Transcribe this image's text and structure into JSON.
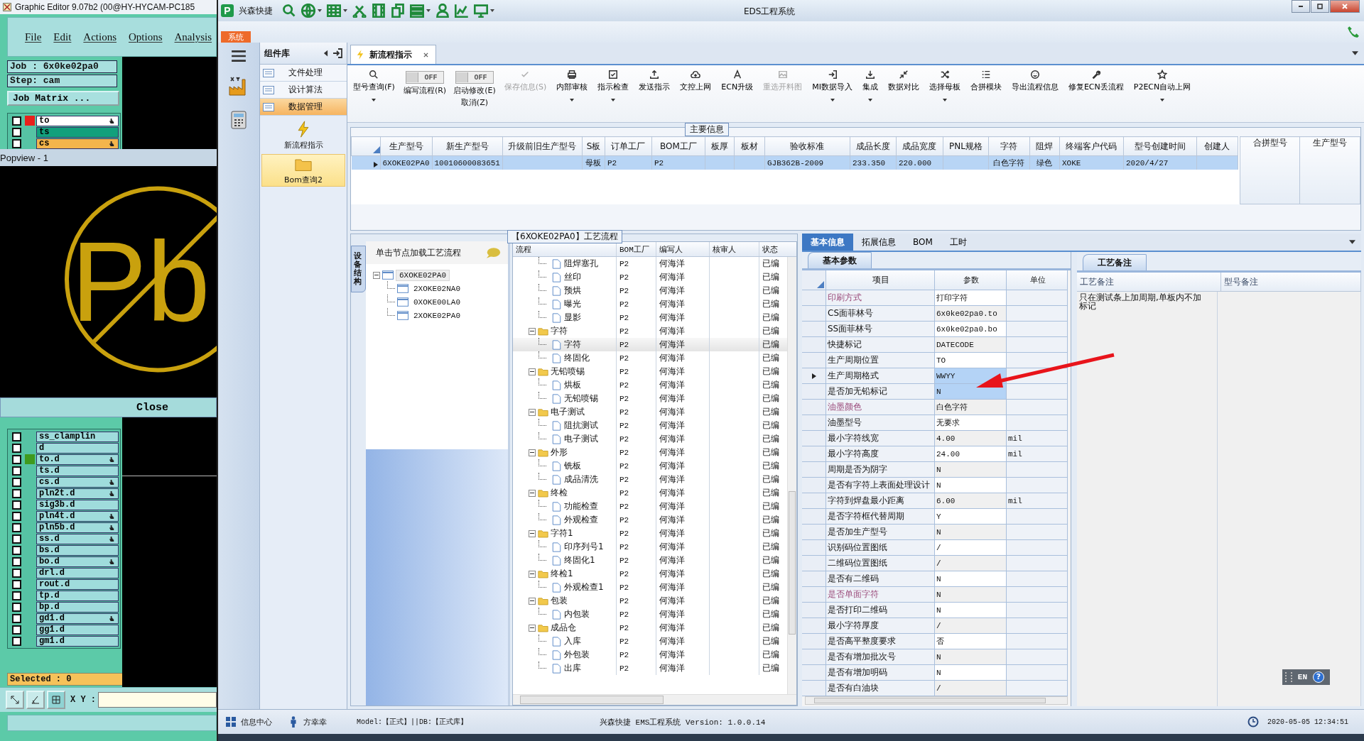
{
  "graphic_editor": {
    "title": "Graphic Editor 9.07b2 (00@HY-HYCAM-PC185",
    "menu": [
      "File",
      "Edit",
      "Actions",
      "Options",
      "Analysis"
    ],
    "job": "Job : 6x0ke02pa0",
    "step": "Step: cam",
    "job_matrix_button": "Job Matrix ...",
    "layers_top": [
      {
        "name": "to",
        "color": "#ffffff",
        "marker": {
          "color": "#e8201c"
        },
        "checked": false,
        "affected": true
      },
      {
        "name": "ts",
        "color": "#12a07c",
        "checked": false,
        "affected": false
      },
      {
        "name": "cs",
        "color": "#f4b54c",
        "checked": false,
        "affected": true
      }
    ],
    "popview": {
      "title": "Popview - 1",
      "symbol_text": "Pb",
      "close_button": "Close"
    },
    "layers_bottom": [
      {
        "name": "ss_clamplin",
        "color": "#9fdcdc",
        "checked": false,
        "affected": false
      },
      {
        "name": "d",
        "color": "#9fdcdc",
        "checked": false,
        "affected": false
      },
      {
        "name": "to.d",
        "color": "#9fdcdc",
        "marker": {
          "color": "#3f9a1e"
        },
        "checked": false,
        "affected": true
      },
      {
        "name": "ts.d",
        "color": "#9fdcdc",
        "checked": false,
        "affected": false
      },
      {
        "name": "cs.d",
        "color": "#9fdcdc",
        "checked": false,
        "affected": true
      },
      {
        "name": "pln2t.d",
        "color": "#9fdcdc",
        "checked": false,
        "affected": true
      },
      {
        "name": "sig3b.d",
        "color": "#9fdcdc",
        "checked": false,
        "affected": false
      },
      {
        "name": "pln4t.d",
        "color": "#9fdcdc",
        "checked": false,
        "affected": true
      },
      {
        "name": "pln5b.d",
        "color": "#9fdcdc",
        "checked": false,
        "affected": true
      },
      {
        "name": "ss.d",
        "color": "#9fdcdc",
        "checked": false,
        "affected": true
      },
      {
        "name": "bs.d",
        "color": "#9fdcdc",
        "checked": false,
        "affected": false
      },
      {
        "name": "bo.d",
        "color": "#9fdcdc",
        "checked": false,
        "affected": true
      },
      {
        "name": "drl.d",
        "color": "#9fdcdc",
        "checked": false,
        "affected": false
      },
      {
        "name": "rout.d",
        "color": "#9fdcdc",
        "checked": false,
        "affected": false
      },
      {
        "name": "tp.d",
        "color": "#9fdcdc",
        "checked": false,
        "affected": false
      },
      {
        "name": "bp.d",
        "color": "#9fdcdc",
        "checked": false,
        "affected": false
      },
      {
        "name": "gd1.d",
        "color": "#9fdcdc",
        "checked": false,
        "affected": true
      },
      {
        "name": "gg1.d",
        "color": "#9fdcdc",
        "checked": false,
        "affected": false
      },
      {
        "name": "gm1.d",
        "color": "#9fdcdc",
        "checked": false,
        "affected": false
      }
    ],
    "selected_count": "Selected : 0",
    "xy_label": "X Y :"
  },
  "app": {
    "logo_text": "P",
    "brand": "兴森快捷",
    "title": "EDS工程系统",
    "system_tab": "系统"
  },
  "component_library": {
    "title": "组件库",
    "categories": [
      {
        "label": "文件处理",
        "selected": false
      },
      {
        "label": "设计算法",
        "selected": false
      },
      {
        "label": "数据管理",
        "selected": true
      }
    ],
    "modules": [
      {
        "label": "新流程指示",
        "kind": "lightning",
        "selected": false
      },
      {
        "label": "Bom查询2",
        "kind": "folder",
        "selected": true
      }
    ]
  },
  "document_tab": {
    "label": "新流程指示"
  },
  "toolbar": [
    {
      "kind": "button",
      "label": "型号查询(F)",
      "dropdown": true,
      "disabled": false
    },
    {
      "kind": "toggle",
      "label": "编写流程(R)",
      "switch_text": "OFF",
      "on": false
    },
    {
      "kind": "toggle",
      "label": "启动修改(E)",
      "sublabel": "取消(Z)",
      "switch_text": "OFF",
      "on": false
    },
    {
      "kind": "button",
      "label": "保存信息(S)",
      "dropdown": false,
      "disabled": true
    },
    {
      "kind": "button",
      "label": "内部审核",
      "dropdown": true,
      "disabled": false
    },
    {
      "kind": "button",
      "label": "指示检查",
      "dropdown": true,
      "disabled": false
    },
    {
      "kind": "button",
      "label": "发送指示",
      "dropdown": false,
      "disabled": false
    },
    {
      "kind": "button",
      "label": "文控上网",
      "dropdown": false,
      "disabled": false
    },
    {
      "kind": "button",
      "label": "ECN升级",
      "dropdown": false,
      "disabled": false
    },
    {
      "kind": "button",
      "label": "重选开料图",
      "dropdown": false,
      "disabled": true
    },
    {
      "kind": "button",
      "label": "MI数据导入",
      "dropdown": true,
      "disabled": false
    },
    {
      "kind": "button",
      "label": "集成",
      "dropdown": true,
      "disabled": false
    },
    {
      "kind": "button",
      "label": "数据对比",
      "dropdown": false,
      "disabled": false
    },
    {
      "kind": "button",
      "label": "选择母板",
      "dropdown": true,
      "disabled": false
    },
    {
      "kind": "button",
      "label": "合拼模块",
      "dropdown": false,
      "disabled": false
    },
    {
      "kind": "button",
      "label": "导出流程信息",
      "dropdown": false,
      "disabled": false
    },
    {
      "kind": "button",
      "label": "修复ECN丢流程",
      "dropdown": false,
      "disabled": false
    },
    {
      "kind": "button",
      "label": "P2ECN自动上网",
      "dropdown": true,
      "disabled": false
    }
  ],
  "main_info": {
    "title": "主要信息",
    "row_selected": true,
    "columns": [
      {
        "label": "生产型号",
        "value": "6XOKE02PA0"
      },
      {
        "label": "新生产型号",
        "value": "10010600083651"
      },
      {
        "label": "升级前旧生产型号"
      },
      {
        "label": "S板",
        "value": "母板"
      },
      {
        "label": "订单工厂",
        "value": "P2"
      },
      {
        "label": "BOM工厂",
        "value": "P2"
      },
      {
        "label": "板厚"
      },
      {
        "label": "板材"
      },
      {
        "label": "验收标准",
        "value": "GJB362B-2009"
      },
      {
        "label": "成品长度",
        "value": "233.350"
      },
      {
        "label": "成品宽度",
        "value": "220.000"
      },
      {
        "label": "PNL规格"
      },
      {
        "label": "字符",
        "value": "白色字符"
      },
      {
        "label": "阻焊",
        "value": "绿色"
      },
      {
        "label": "终端客户代码",
        "value": "XOKE"
      },
      {
        "label": "型号创建时间",
        "value": "2020/4/27"
      },
      {
        "label": "创建人"
      }
    ],
    "side_columns": [
      "合拼型号",
      "生产型号"
    ]
  },
  "process": {
    "title": "【6XOKE02PA0】工艺流程",
    "side_tab": "设备结构",
    "tree_hint": "单击节点加载工艺流程",
    "structure": [
      {
        "label": "6XOKE02PA0",
        "expanded": true,
        "selected": true,
        "children": [
          {
            "label": "2XOKE02NA0",
            "selected": false
          },
          {
            "label": "0XOKE00LA0",
            "selected": false
          },
          {
            "label": "2XOKE02PA0",
            "selected": false
          }
        ]
      }
    ],
    "grid_columns": [
      "流程",
      "BOM工厂",
      "编写人",
      "核审人",
      "状态"
    ],
    "rows": [
      {
        "kind": "file",
        "name": "阻焊塞孔",
        "bom": "P2",
        "author": "何海洋",
        "status": "已编",
        "selected": false
      },
      {
        "kind": "file",
        "name": "丝印",
        "bom": "P2",
        "author": "何海洋",
        "status": "已编",
        "selected": false
      },
      {
        "kind": "file",
        "name": "预烘",
        "bom": "P2",
        "author": "何海洋",
        "status": "已编",
        "selected": false
      },
      {
        "kind": "file",
        "name": "曝光",
        "bom": "P2",
        "author": "何海洋",
        "status": "已编",
        "selected": false
      },
      {
        "kind": "file",
        "name": "显影",
        "bom": "P2",
        "author": "何海洋",
        "status": "已编",
        "selected": false
      },
      {
        "kind": "folder",
        "name": "字符",
        "bom": "P2",
        "author": "何海洋",
        "status": "已编",
        "selected": false,
        "expanded": true,
        "children": [
          {
            "kind": "file",
            "name": "字符",
            "bom": "P2",
            "author": "何海洋",
            "status": "已编",
            "selected": true
          },
          {
            "kind": "file",
            "name": "终固化",
            "bom": "P2",
            "author": "何海洋",
            "status": "已编",
            "selected": false
          }
        ]
      },
      {
        "kind": "folder",
        "name": "无铅喷锡",
        "bom": "P2",
        "author": "何海洋",
        "status": "已编",
        "selected": false,
        "expanded": true,
        "children": [
          {
            "kind": "file",
            "name": "烘板",
            "bom": "P2",
            "author": "何海洋",
            "status": "已编",
            "selected": false
          },
          {
            "kind": "file",
            "name": "无铅喷锡",
            "bom": "P2",
            "author": "何海洋",
            "status": "已编",
            "selected": false
          }
        ]
      },
      {
        "kind": "folder",
        "name": "电子测试",
        "bom": "P2",
        "author": "何海洋",
        "status": "已编",
        "selected": false,
        "expanded": true,
        "children": [
          {
            "kind": "file",
            "name": "阻抗测试",
            "bom": "P2",
            "author": "何海洋",
            "status": "已编",
            "selected": false
          },
          {
            "kind": "file",
            "name": "电子测试",
            "bom": "P2",
            "author": "何海洋",
            "status": "已编",
            "selected": false
          }
        ]
      },
      {
        "kind": "folder",
        "name": "外形",
        "bom": "P2",
        "author": "何海洋",
        "status": "已编",
        "selected": false,
        "expanded": true,
        "children": [
          {
            "kind": "file",
            "name": "铣板",
            "bom": "P2",
            "author": "何海洋",
            "status": "已编",
            "selected": false
          },
          {
            "kind": "file",
            "name": "成品清洗",
            "bom": "P2",
            "author": "何海洋",
            "status": "已编",
            "selected": false
          }
        ]
      },
      {
        "kind": "folder",
        "name": "终检",
        "bom": "P2",
        "author": "何海洋",
        "status": "已编",
        "selected": false,
        "expanded": true,
        "children": [
          {
            "kind": "file",
            "name": "功能检查",
            "bom": "P2",
            "author": "何海洋",
            "status": "已编",
            "selected": false
          },
          {
            "kind": "file",
            "name": "外观检查",
            "bom": "P2",
            "author": "何海洋",
            "status": "已编",
            "selected": false
          }
        ]
      },
      {
        "kind": "folder",
        "name": "字符1",
        "bom": "P2",
        "author": "何海洋",
        "status": "已编",
        "selected": false,
        "expanded": true,
        "children": [
          {
            "kind": "file",
            "name": "印序列号1",
            "bom": "P2",
            "author": "何海洋",
            "status": "已编",
            "selected": false
          },
          {
            "kind": "file",
            "name": "终固化1",
            "bom": "P2",
            "author": "何海洋",
            "status": "已编",
            "selected": false
          }
        ]
      },
      {
        "kind": "folder",
        "name": "终检1",
        "bom": "P2",
        "author": "何海洋",
        "status": "已编",
        "selected": false,
        "expanded": true,
        "children": [
          {
            "kind": "file",
            "name": "外观检查1",
            "bom": "P2",
            "author": "何海洋",
            "status": "已编",
            "selected": false
          }
        ]
      },
      {
        "kind": "folder",
        "name": "包装",
        "bom": "P2",
        "author": "何海洋",
        "status": "已编",
        "selected": false,
        "expanded": true,
        "children": [
          {
            "kind": "file",
            "name": "内包装",
            "bom": "P2",
            "author": "何海洋",
            "status": "已编",
            "selected": false
          }
        ]
      },
      {
        "kind": "folder",
        "name": "成品仓",
        "bom": "P2",
        "author": "何海洋",
        "status": "已编",
        "selected": false,
        "expanded": true,
        "children": [
          {
            "kind": "file",
            "name": "入库",
            "bom": "P2",
            "author": "何海洋",
            "status": "已编",
            "selected": false
          },
          {
            "kind": "file",
            "name": "外包装",
            "bom": "P2",
            "author": "何海洋",
            "status": "已编",
            "selected": false
          },
          {
            "kind": "file",
            "name": "出库",
            "bom": "P2",
            "author": "何海洋",
            "status": "已编",
            "selected": false
          }
        ]
      }
    ]
  },
  "detail_tabs": [
    {
      "label": "基本信息",
      "selected": true
    },
    {
      "label": "拓展信息",
      "selected": false
    },
    {
      "label": "BOM",
      "selected": false
    },
    {
      "label": "工时",
      "selected": false
    }
  ],
  "params": {
    "tab": "基本参数",
    "columns": [
      "项目",
      "参数",
      "单位"
    ],
    "rows": [
      {
        "item": "印刷方式",
        "value": "打印字符",
        "highlight": true,
        "current": false,
        "selected": false
      },
      {
        "item": "CS面菲林号",
        "value": "6x0ke02pa0.to",
        "highlight": false,
        "current": false,
        "selected": false
      },
      {
        "item": "SS面菲林号",
        "value": "6x0ke02pa0.bo",
        "highlight": false,
        "current": false,
        "selected": false
      },
      {
        "item": "快捷标记",
        "value": "DATECODE",
        "highlight": false,
        "current": false,
        "selected": false
      },
      {
        "item": "生产周期位置",
        "value": "TO",
        "highlight": false,
        "current": false,
        "selected": false
      },
      {
        "item": "生产周期格式",
        "value": "WWYY",
        "highlight": false,
        "current": true,
        "selected": true
      },
      {
        "item": "是否加无铅标记",
        "value": "N",
        "highlight": false,
        "current": false,
        "selected": true
      },
      {
        "item": "油墨颜色",
        "value": "白色字符",
        "highlight": true,
        "current": false,
        "selected": false
      },
      {
        "item": "油墨型号",
        "value": "无要求",
        "highlight": false,
        "current": false,
        "selected": false
      },
      {
        "item": "最小字符线宽",
        "value": "4.00",
        "unit": "mil",
        "highlight": false,
        "current": false,
        "selected": false
      },
      {
        "item": "最小字符高度",
        "value": "24.00",
        "unit": "mil",
        "highlight": false,
        "current": false,
        "selected": false
      },
      {
        "item": "周期是否为阴字",
        "value": "N",
        "highlight": false,
        "current": false,
        "selected": false
      },
      {
        "item": "是否有字符上表面处理设计",
        "value": "N",
        "highlight": false,
        "current": false,
        "selected": false
      },
      {
        "item": "字符到焊盘最小距离",
        "value": "6.00",
        "unit": "mil",
        "highlight": false,
        "current": false,
        "selected": false
      },
      {
        "item": "是否字符框代替周期",
        "value": "Y",
        "highlight": false,
        "current": false,
        "selected": false
      },
      {
        "item": "是否加生产型号",
        "value": "N",
        "highlight": false,
        "current": false,
        "selected": false
      },
      {
        "item": "识别码位置图纸",
        "value": "/",
        "highlight": false,
        "current": false,
        "selected": false
      },
      {
        "item": "二维码位置图纸",
        "value": "/",
        "highlight": false,
        "current": false,
        "selected": false
      },
      {
        "item": "是否有二维码",
        "value": "N",
        "highlight": false,
        "current": false,
        "selected": false
      },
      {
        "item": "是否单面字符",
        "value": "N",
        "highlight": true,
        "current": false,
        "selected": false
      },
      {
        "item": "是否打印二维码",
        "value": "N",
        "highlight": false,
        "current": false,
        "selected": false
      },
      {
        "item": "最小字符厚度",
        "value": "/",
        "highlight": false,
        "current": false,
        "selected": false
      },
      {
        "item": "是否高平整度要求",
        "value": "否",
        "highlight": false,
        "current": false,
        "selected": false
      },
      {
        "item": "是否有增加批次号",
        "value": "N",
        "highlight": false,
        "current": false,
        "selected": false
      },
      {
        "item": "是否有增加明码",
        "value": "N",
        "highlight": false,
        "current": false,
        "selected": false
      },
      {
        "item": "是否有白油块",
        "value": "/",
        "highlight": false,
        "current": false,
        "selected": false
      }
    ]
  },
  "notes": {
    "tab": "工艺备注",
    "columns": [
      "工艺备注",
      "型号备注"
    ],
    "process_note": "只在测试条上加周期,单板内不加标记"
  },
  "language_bar": {
    "label": "EN",
    "help": "?"
  },
  "status_bar": {
    "info_center": "信息中心",
    "user": "方幸幸",
    "model": "Model:【正式】||DB:【正式库】",
    "app_version": "兴森快捷 EMS工程系统 Version: 1.0.0.14",
    "datetime": "2020-05-05 12:34:51"
  }
}
